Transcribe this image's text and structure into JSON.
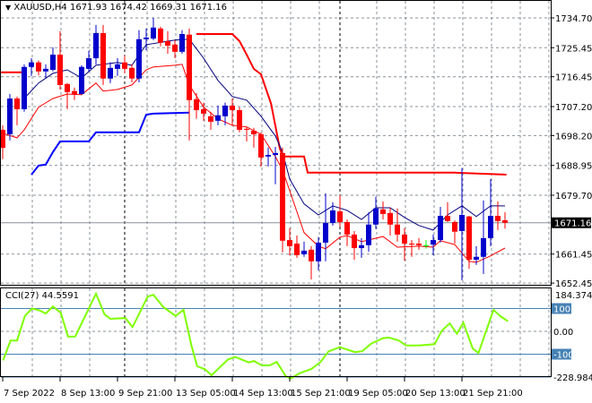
{
  "header": {
    "symbol": "XAUUSD,H4",
    "open": "1671.93",
    "high": "1674.42",
    "low": "1669.31",
    "close": "1671.16"
  },
  "colors": {
    "bull": "#0000cc",
    "bear": "#ff0000",
    "doji": "#00ff00",
    "ma_fast": "#000080",
    "ma_slow": "#ff0000",
    "upper_band": "#ff0000",
    "lower_band": "#0000ff",
    "cci": "#7fff00",
    "level_line": "#4682b4"
  },
  "price_axis": {
    "ticks": [
      "1734.70",
      "1725.45",
      "1716.45",
      "1707.20",
      "1698.20",
      "1688.95",
      "1679.70",
      "1661.45",
      "1652.45"
    ],
    "tick_values": [
      1734.7,
      1725.45,
      1716.45,
      1707.2,
      1698.2,
      1688.95,
      1679.7,
      1661.45,
      1652.45
    ],
    "current_price_label": "1671.16",
    "current_price": 1671.16
  },
  "cci_panel": {
    "label": "CCI(27) 44.5591",
    "max_label": "184.3749",
    "min_label": "-228.9844",
    "levels": [
      {
        "label": "100",
        "value": 100
      },
      {
        "label": "0.00",
        "value": 0
      },
      {
        "label": "-100",
        "value": -100
      }
    ]
  },
  "time_axis": {
    "labels": [
      "7 Sep 2022",
      "8 Sep 13:00",
      "9 Sep 21:00",
      "13 Sep 05:00",
      "14 Sep 13:00",
      "15 Sep 21:00",
      "19 Sep 05:00",
      "20 Sep 13:00",
      "21 Sep 21:00"
    ],
    "label_bars": [
      1,
      9,
      17,
      25,
      33,
      41,
      49,
      57,
      65
    ]
  },
  "chart_data": {
    "type": "candlestick",
    "title": "XAUUSD,H4",
    "ylim": [
      1652.45,
      1734.7
    ],
    "candles_ohlc": [
      [
        1700.0,
        1701.4,
        1690.9,
        1694.4
      ],
      [
        1698.6,
        1711.1,
        1696.7,
        1709.7
      ],
      [
        1709.7,
        1710.3,
        1701.4,
        1706.4
      ],
      [
        1706.4,
        1720.3,
        1705.6,
        1719.5
      ],
      [
        1719.5,
        1722.2,
        1716.7,
        1720.9
      ],
      [
        1720.9,
        1721.5,
        1716.9,
        1718.1
      ],
      [
        1718.1,
        1720.3,
        1715.9,
        1718.9
      ],
      [
        1718.6,
        1725.6,
        1718.1,
        1723.3
      ],
      [
        1723.3,
        1730.6,
        1712.5,
        1713.9
      ],
      [
        1714.2,
        1714.5,
        1706.4,
        1711.7
      ],
      [
        1712.0,
        1713.1,
        1709.2,
        1710.9
      ],
      [
        1711.1,
        1720.0,
        1710.9,
        1719.5
      ],
      [
        1718.9,
        1724.5,
        1718.1,
        1722.2
      ],
      [
        1722.2,
        1732.5,
        1720.3,
        1730.0
      ],
      [
        1730.0,
        1732.5,
        1713.9,
        1715.9
      ],
      [
        1715.9,
        1720.9,
        1714.5,
        1719.2
      ],
      [
        1718.9,
        1722.2,
        1716.7,
        1720.3
      ],
      [
        1720.9,
        1723.1,
        1717.5,
        1718.9
      ],
      [
        1719.2,
        1720.3,
        1714.7,
        1715.9
      ],
      [
        1715.9,
        1730.9,
        1714.7,
        1728.1
      ],
      [
        1728.1,
        1731.4,
        1724.7,
        1728.6
      ],
      [
        1728.3,
        1734.7,
        1727.8,
        1731.7
      ],
      [
        1731.4,
        1732.0,
        1725.9,
        1727.0
      ],
      [
        1727.5,
        1730.6,
        1723.6,
        1726.1
      ],
      [
        1726.4,
        1727.8,
        1722.2,
        1724.2
      ],
      [
        1724.2,
        1730.9,
        1723.6,
        1729.7
      ],
      [
        1729.5,
        1731.4,
        1696.7,
        1709.2
      ],
      [
        1709.5,
        1711.4,
        1703.4,
        1706.1
      ],
      [
        1706.4,
        1708.4,
        1702.8,
        1705.0
      ],
      [
        1704.2,
        1705.6,
        1700.0,
        1702.5
      ],
      [
        1702.8,
        1707.5,
        1701.4,
        1704.5
      ],
      [
        1704.2,
        1708.4,
        1701.4,
        1707.5
      ],
      [
        1707.5,
        1709.7,
        1701.4,
        1706.1
      ],
      [
        1706.1,
        1707.0,
        1699.2,
        1700.0
      ],
      [
        1700.3,
        1700.9,
        1696.4,
        1700.0
      ],
      [
        1699.7,
        1700.6,
        1694.5,
        1698.6
      ],
      [
        1698.6,
        1699.2,
        1688.6,
        1691.4
      ],
      [
        1691.7,
        1694.5,
        1688.6,
        1692.2
      ],
      [
        1692.2,
        1694.7,
        1683.1,
        1692.8
      ],
      [
        1692.8,
        1694.5,
        1662.0,
        1665.6
      ],
      [
        1665.8,
        1669.5,
        1661.1,
        1663.9
      ],
      [
        1664.7,
        1667.2,
        1660.3,
        1661.1
      ],
      [
        1661.4,
        1665.3,
        1660.6,
        1662.5
      ],
      [
        1662.8,
        1663.9,
        1653.6,
        1659.2
      ],
      [
        1659.2,
        1666.7,
        1656.4,
        1665.0
      ],
      [
        1665.0,
        1680.3,
        1659.2,
        1671.1
      ],
      [
        1671.1,
        1677.5,
        1670.3,
        1675.0
      ],
      [
        1674.7,
        1679.7,
        1670.0,
        1671.4
      ],
      [
        1671.4,
        1672.2,
        1663.9,
        1667.5
      ],
      [
        1667.5,
        1668.6,
        1659.7,
        1663.3
      ],
      [
        1663.3,
        1666.4,
        1660.3,
        1664.2
      ],
      [
        1664.2,
        1674.4,
        1662.2,
        1670.6
      ],
      [
        1670.6,
        1679.2,
        1669.2,
        1675.6
      ],
      [
        1675.3,
        1677.8,
        1672.2,
        1673.9
      ],
      [
        1674.2,
        1675.8,
        1667.2,
        1670.6
      ],
      [
        1670.6,
        1675.6,
        1665.3,
        1667.5
      ],
      [
        1667.5,
        1669.5,
        1659.4,
        1664.7
      ],
      [
        1664.7,
        1665.8,
        1660.6,
        1664.4
      ],
      [
        1664.7,
        1666.4,
        1662.8,
        1664.2
      ],
      [
        1664.2,
        1665.8,
        1663.1,
        1664.2
      ],
      [
        1664.4,
        1667.5,
        1661.1,
        1665.8
      ],
      [
        1665.8,
        1676.1,
        1665.0,
        1673.3
      ],
      [
        1673.3,
        1677.5,
        1671.4,
        1671.7
      ],
      [
        1671.4,
        1671.9,
        1664.7,
        1668.4
      ],
      [
        1668.6,
        1688.1,
        1653.3,
        1673.6
      ],
      [
        1673.1,
        1673.3,
        1656.9,
        1659.7
      ],
      [
        1659.7,
        1663.9,
        1658.1,
        1660.6
      ],
      [
        1660.6,
        1678.1,
        1655.3,
        1666.4
      ],
      [
        1666.4,
        1684.7,
        1663.9,
        1673.3
      ],
      [
        1673.3,
        1677.8,
        1668.9,
        1671.7
      ],
      [
        1671.93,
        1674.42,
        1669.31,
        1671.16
      ]
    ],
    "ma_fast": [
      [
        4,
        1709.7
      ],
      [
        6,
        1714.5
      ],
      [
        8,
        1717.5
      ],
      [
        10,
        1718.6
      ],
      [
        12,
        1716.1
      ],
      [
        14,
        1720.0
      ],
      [
        17,
        1720.9
      ],
      [
        19,
        1720.0
      ],
      [
        21,
        1726.4
      ],
      [
        25,
        1727.8
      ],
      [
        27,
        1728.1
      ],
      [
        29,
        1722.2
      ],
      [
        31,
        1715.3
      ],
      [
        33,
        1710.3
      ],
      [
        35,
        1709.2
      ],
      [
        37,
        1704.2
      ],
      [
        39,
        1698.1
      ],
      [
        40,
        1693.1
      ],
      [
        41,
        1684.7
      ],
      [
        43,
        1677.0
      ],
      [
        45,
        1673.6
      ],
      [
        47,
        1676.4
      ],
      [
        49,
        1675.0
      ],
      [
        51,
        1672.2
      ],
      [
        53,
        1675.8
      ],
      [
        55,
        1675.8
      ],
      [
        57,
        1672.8
      ],
      [
        59,
        1670.3
      ],
      [
        61,
        1668.9
      ],
      [
        63,
        1673.6
      ],
      [
        65,
        1676.4
      ],
      [
        67,
        1673.1
      ],
      [
        69,
        1676.4
      ],
      [
        71,
        1676.4
      ]
    ],
    "ma_slow": [
      [
        0.6,
        1699.2
      ],
      [
        3,
        1697.5
      ],
      [
        4,
        1700.0
      ],
      [
        6,
        1707.0
      ],
      [
        8,
        1709.7
      ],
      [
        10,
        1711.1
      ],
      [
        12,
        1710.9
      ],
      [
        14,
        1714.5
      ],
      [
        15,
        1712.0
      ],
      [
        17,
        1712.5
      ],
      [
        19,
        1713.9
      ],
      [
        21,
        1718.6
      ],
      [
        22,
        1719.5
      ],
      [
        25,
        1720.0
      ],
      [
        26,
        1720.3
      ],
      [
        27,
        1713.9
      ],
      [
        29,
        1707.0
      ],
      [
        31,
        1703.4
      ],
      [
        33,
        1701.4
      ],
      [
        35,
        1700.9
      ],
      [
        37,
        1698.6
      ],
      [
        39,
        1691.7
      ],
      [
        40,
        1687.5
      ],
      [
        41,
        1681.1
      ],
      [
        43,
        1668.1
      ],
      [
        45,
        1663.9
      ],
      [
        46,
        1663.1
      ],
      [
        48,
        1666.7
      ],
      [
        49,
        1667.2
      ],
      [
        51,
        1665.3
      ],
      [
        54,
        1666.9
      ],
      [
        56,
        1663.6
      ],
      [
        59,
        1663.9
      ],
      [
        61,
        1663.6
      ],
      [
        62,
        1665.6
      ],
      [
        64,
        1664.4
      ],
      [
        66,
        1659.2
      ],
      [
        67,
        1658.9
      ],
      [
        69,
        1660.9
      ],
      [
        71,
        1663.3
      ]
    ],
    "upper_band": [
      [
        0.6,
        1717.8
      ],
      [
        4,
        1717.8
      ],
      [
        null,
        null
      ],
      [
        28,
        1729.7
      ],
      [
        33,
        1729.7
      ],
      [
        34,
        1727.5
      ],
      [
        35,
        1723.3
      ],
      [
        36,
        1718.9
      ],
      [
        37,
        1717.2
      ],
      [
        38.4,
        1708.1
      ],
      [
        39.6,
        1694.4
      ],
      [
        40,
        1691.7
      ],
      [
        43,
        1691.7
      ],
      [
        43.5,
        1686.7
      ],
      [
        64,
        1686.7
      ],
      [
        71.2,
        1686.1
      ]
    ],
    "lower_band": [
      [
        5,
        1686.1
      ],
      [
        6,
        1688.9
      ],
      [
        7,
        1689.2
      ],
      [
        8,
        1693.1
      ],
      [
        9,
        1696.4
      ],
      [
        13,
        1696.4
      ],
      [
        14,
        1699.2
      ],
      [
        20,
        1699.2
      ],
      [
        21,
        1704.7
      ],
      [
        22,
        1705.0
      ],
      [
        27,
        1705.3
      ]
    ],
    "cci": [
      [
        1.05,
        -127
      ],
      [
        2.1,
        -40
      ],
      [
        3,
        -40
      ],
      [
        4.1,
        68
      ],
      [
        5.1,
        100
      ],
      [
        6.2,
        91
      ],
      [
        7,
        78
      ],
      [
        8,
        109
      ],
      [
        9.1,
        81
      ],
      [
        10.1,
        -23
      ],
      [
        11.1,
        -23
      ],
      [
        12.8,
        87
      ],
      [
        14,
        165
      ],
      [
        15.2,
        74
      ],
      [
        16,
        55
      ],
      [
        18.1,
        58
      ],
      [
        19.1,
        19
      ],
      [
        21.2,
        152
      ],
      [
        22,
        160
      ],
      [
        23.4,
        106
      ],
      [
        25.1,
        68
      ],
      [
        26.2,
        94
      ],
      [
        27.3,
        -62
      ],
      [
        28.1,
        -153
      ],
      [
        29.2,
        -166
      ],
      [
        30.1,
        -192
      ],
      [
        32.4,
        -123
      ],
      [
        33.4,
        -112
      ],
      [
        35.3,
        -136
      ],
      [
        36,
        -130
      ],
      [
        37.1,
        -149
      ],
      [
        38.2,
        -149
      ],
      [
        39.2,
        -134
      ],
      [
        40.5,
        -199
      ],
      [
        41.2,
        -206
      ],
      [
        42.4,
        -183
      ],
      [
        44,
        -165
      ],
      [
        45.3,
        -134
      ],
      [
        46.4,
        -88
      ],
      [
        48,
        -69
      ],
      [
        50.1,
        -91
      ],
      [
        51.1,
        -87
      ],
      [
        52.4,
        -53
      ],
      [
        54,
        -30
      ],
      [
        54.8,
        -27
      ],
      [
        56.2,
        -40
      ],
      [
        57.2,
        -62
      ],
      [
        59.1,
        -62
      ],
      [
        61.2,
        -56
      ],
      [
        62.2,
        3
      ],
      [
        63.3,
        35
      ],
      [
        64.3,
        -10
      ],
      [
        65.2,
        38
      ],
      [
        66.5,
        -75
      ],
      [
        67.3,
        -95
      ],
      [
        69.4,
        94
      ],
      [
        70.4,
        65
      ],
      [
        71.4,
        44.56
      ]
    ],
    "cci_range": [
      -228.9844,
      184.3749
    ]
  }
}
